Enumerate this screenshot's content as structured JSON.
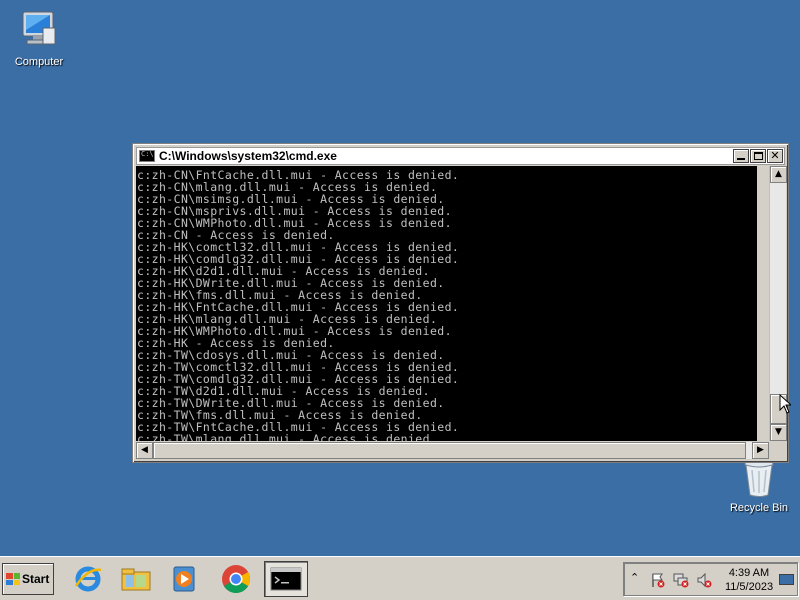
{
  "desktop": {
    "icons": [
      {
        "label": "Computer"
      },
      {
        "label": "Recycle Bin"
      }
    ]
  },
  "window": {
    "title": "C:\\Windows\\system32\\cmd.exe",
    "lines": [
      "c:zh-CN\\FntCache.dll.mui - Access is denied.",
      "c:zh-CN\\mlang.dll.mui - Access is denied.",
      "c:zh-CN\\msimsg.dll.mui - Access is denied.",
      "c:zh-CN\\msprivs.dll.mui - Access is denied.",
      "c:zh-CN\\WMPhoto.dll.mui - Access is denied.",
      "c:zh-CN - Access is denied.",
      "c:zh-HK\\comctl32.dll.mui - Access is denied.",
      "c:zh-HK\\comdlg32.dll.mui - Access is denied.",
      "c:zh-HK\\d2d1.dll.mui - Access is denied.",
      "c:zh-HK\\DWrite.dll.mui - Access is denied.",
      "c:zh-HK\\fms.dll.mui - Access is denied.",
      "c:zh-HK\\FntCache.dll.mui - Access is denied.",
      "c:zh-HK\\mlang.dll.mui - Access is denied.",
      "c:zh-HK\\WMPhoto.dll.mui - Access is denied.",
      "c:zh-HK - Access is denied.",
      "c:zh-TW\\cdosys.dll.mui - Access is denied.",
      "c:zh-TW\\comctl32.dll.mui - Access is denied.",
      "c:zh-TW\\comdlg32.dll.mui - Access is denied.",
      "c:zh-TW\\d2d1.dll.mui - Access is denied.",
      "c:zh-TW\\DWrite.dll.mui - Access is denied.",
      "c:zh-TW\\fms.dll.mui - Access is denied.",
      "c:zh-TW\\FntCache.dll.mui - Access is denied.",
      "c:zh-TW\\mlang.dll.mui - Access is denied."
    ]
  },
  "taskbar": {
    "start_label": "Start",
    "apps": [
      {
        "icon": "internet-explorer-icon"
      },
      {
        "icon": "file-explorer-icon"
      },
      {
        "icon": "media-player-icon"
      },
      {
        "icon": "chrome-icon"
      },
      {
        "icon": "cmd-icon"
      }
    ],
    "clock": {
      "time": "4:39 AM",
      "date": "11/5/2023"
    }
  },
  "colors": {
    "desktop": "#3a6ea5",
    "console_bg": "#000000",
    "console_text": "#c0c0c0",
    "chrome_face": "#d4d0c8"
  }
}
